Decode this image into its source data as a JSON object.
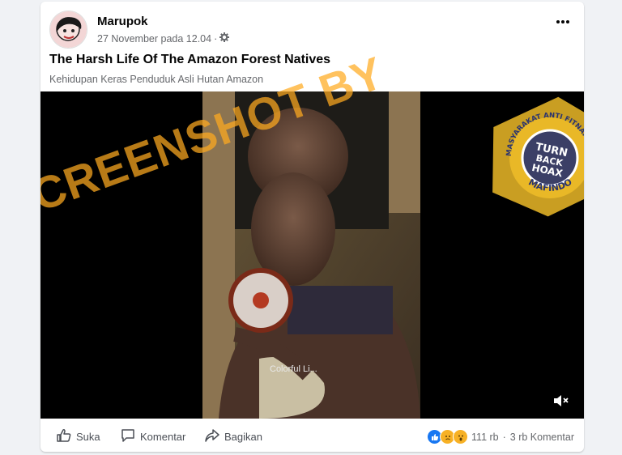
{
  "post": {
    "author": "Marupok",
    "date": "27 November pada 12.04",
    "separator": "·",
    "title": "The Harsh Life Of The Amazon Forest Natives",
    "subtitle": "Kehidupan Keras Penduduk Asli Hutan Amazon"
  },
  "video": {
    "overlay_caption": "Colorful Li..."
  },
  "watermark": {
    "text": "SCREENSHOT BY",
    "seal_top": "MASYARAKAT ANTI FITNAH INDONESIA",
    "seal_bottom": "MAFINDO",
    "seal_line1": "TURN",
    "seal_line2": "BACK",
    "seal_line3": "HOAX",
    "color": "#ffab20"
  },
  "actions": {
    "like": "Suka",
    "comment": "Komentar",
    "share": "Bagikan"
  },
  "stats": {
    "reactions_count": "111 rb",
    "dot": "·",
    "comments_count": "3 rb Komentar"
  },
  "icons": {
    "settings": "gear-icon",
    "more": "more-icon",
    "mute": "mute-icon",
    "like": "thumbs-up-icon",
    "comment": "comment-icon",
    "share": "share-icon"
  }
}
